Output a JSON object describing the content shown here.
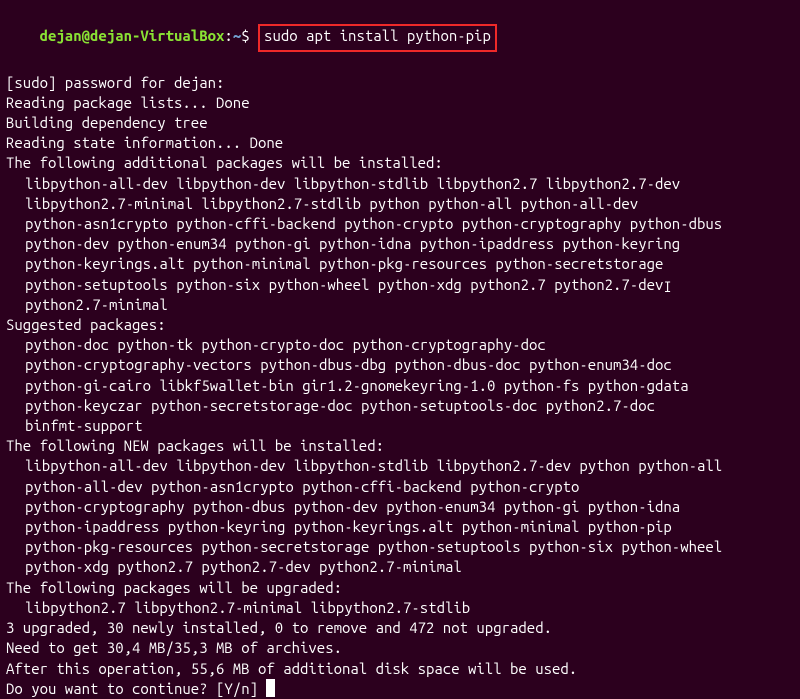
{
  "prompt": {
    "user_host": "dejan@dejan-VirtualBox",
    "colon": ":",
    "path": "~",
    "dollar": "$ ",
    "command": "sudo apt install python-pip"
  },
  "lines": {
    "l1": "[sudo] password for dejan: ",
    "l2": "Reading package lists... Done",
    "l3": "Building dependency tree",
    "l4": "Reading state information... Done",
    "l5": "The following additional packages will be installed:",
    "l6": "libpython-all-dev libpython-dev libpython-stdlib libpython2.7 libpython2.7-dev",
    "l7": "libpython2.7-minimal libpython2.7-stdlib python python-all python-all-dev",
    "l8": "python-asn1crypto python-cffi-backend python-crypto python-cryptography python-dbus",
    "l9": "python-dev python-enum34 python-gi python-idna python-ipaddress python-keyring",
    "l10": "python-keyrings.alt python-minimal python-pkg-resources python-secretstorage",
    "l11a": "python-setuptools python-six python-wheel python-xdg python2.7 python2.7-dev",
    "l11b": "python2.7-minimal",
    "l12": "Suggested packages:",
    "l13": "python-doc python-tk python-crypto-doc python-cryptography-doc",
    "l14": "python-cryptography-vectors python-dbus-dbg python-dbus-doc python-enum34-doc",
    "l15": "python-gi-cairo libkf5wallet-bin gir1.2-gnomekeyring-1.0 python-fs python-gdata",
    "l16": "python-keyczar python-secretstorage-doc python-setuptools-doc python2.7-doc",
    "l17": "binfmt-support",
    "l18": "The following NEW packages will be installed:",
    "l19": "libpython-all-dev libpython-dev libpython-stdlib libpython2.7-dev python python-all",
    "l20": "python-all-dev python-asn1crypto python-cffi-backend python-crypto",
    "l21": "python-cryptography python-dbus python-dev python-enum34 python-gi python-idna",
    "l22": "python-ipaddress python-keyring python-keyrings.alt python-minimal python-pip",
    "l23": "python-pkg-resources python-secretstorage python-setuptools python-six python-wheel",
    "l24": "python-xdg python2.7 python2.7-dev python2.7-minimal",
    "l25": "The following packages will be upgraded:",
    "l26": "libpython2.7 libpython2.7-minimal libpython2.7-stdlib",
    "l27": "3 upgraded, 30 newly installed, 0 to remove and 472 not upgraded.",
    "l28": "Need to get 30,4 MB/35,3 MB of archives.",
    "l29": "After this operation, 55,6 MB of additional disk space will be used.",
    "l30": "Do you want to continue? [Y/n] "
  }
}
